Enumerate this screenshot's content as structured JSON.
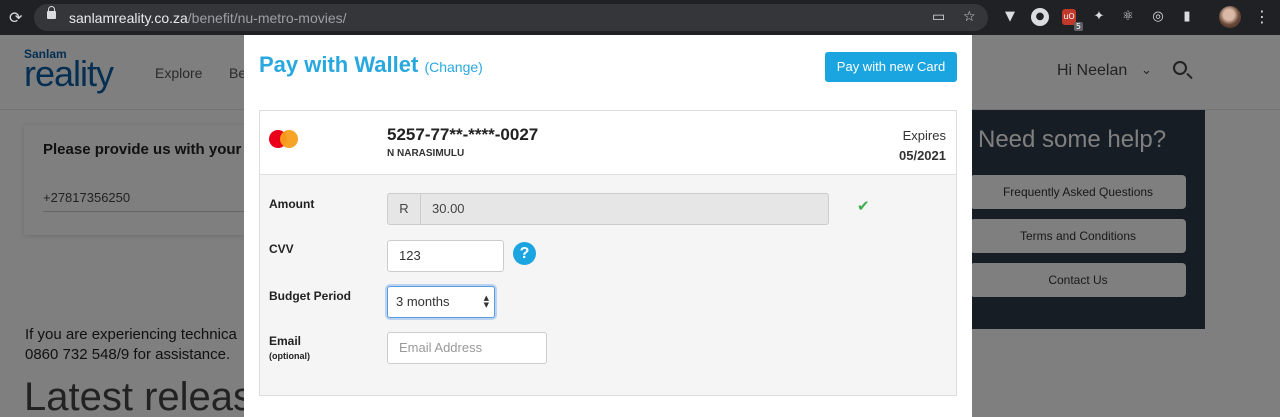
{
  "browser": {
    "url_host": "sanlamreality.co.za",
    "url_path": "/benefit/nu-metro-movies/",
    "extension_badge": "5"
  },
  "site": {
    "logo_small": "Sanlam",
    "logo_big": "reality",
    "nav": [
      "Explore",
      "Be"
    ],
    "greeting": "Hi Neelan",
    "form_prompt": "Please provide us with your c",
    "phone_value": "+27817356250",
    "tech_line1": "If you are experiencing technica",
    "tech_line2": "0860 732 548/9 for assistance.",
    "latest": "Latest release"
  },
  "help": {
    "title": "Need some help?",
    "buttons": [
      "Frequently Asked Questions",
      "Terms and Conditions",
      "Contact Us"
    ]
  },
  "modal": {
    "title": "Pay with Wallet",
    "change": "(Change)",
    "new_card_button": "Pay with new Card",
    "card": {
      "number": "5257-77**-****-0027",
      "holder": "N NARASIMULU",
      "expires_label": "Expires",
      "expires_value": "05/2021"
    },
    "fields": {
      "amount_label": "Amount",
      "currency": "R",
      "amount_value": "30.00",
      "cvv_label": "CVV",
      "cvv_value": "123",
      "cvv_help": "?",
      "budget_label": "Budget Period",
      "budget_value": "3 months",
      "email_label": "Email",
      "email_sub": "(optional)",
      "email_placeholder": "Email Address"
    }
  },
  "colors": {
    "accent": "#1ba5e0",
    "chrome": "#202124",
    "help_panel": "#2f3a49",
    "check": "#3cae4a"
  }
}
